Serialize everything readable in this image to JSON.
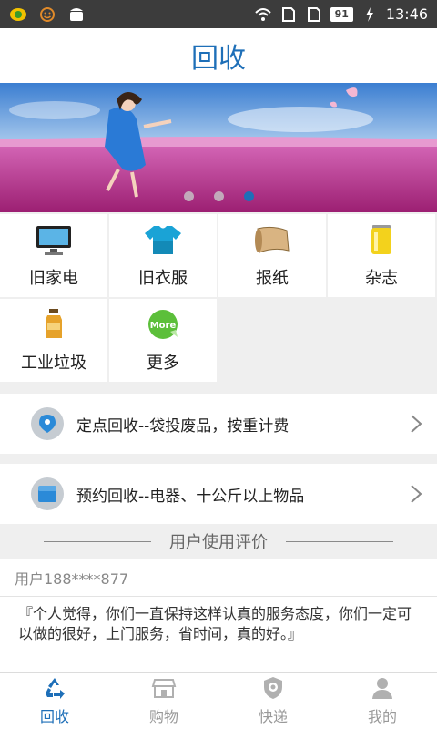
{
  "status_bar": {
    "battery": "91",
    "time": "13:46"
  },
  "header": {
    "title": "回收"
  },
  "banner": {
    "dots": 3,
    "active_dot": 2
  },
  "categories": [
    {
      "label": "旧家电",
      "icon": "monitor-icon"
    },
    {
      "label": "旧衣服",
      "icon": "tshirt-icon"
    },
    {
      "label": "报纸",
      "icon": "paper-scroll-icon"
    },
    {
      "label": "杂志",
      "icon": "can-icon"
    },
    {
      "label": "工业垃圾",
      "icon": "bottle-icon"
    },
    {
      "label": "更多",
      "icon": "more-icon"
    }
  ],
  "list": [
    {
      "text": "定点回收--袋投废品，按重计费",
      "icon": "location-pin-icon"
    },
    {
      "text": "预约回收--电器、十公斤以上物品",
      "icon": "box-icon"
    }
  ],
  "reviews": {
    "section_title": "用户使用评价",
    "user": "用户188****877",
    "text": "『个人觉得，你们一直保持这样认真的服务态度，你们一定可以做的很好，上门服务，省时间，真的好。』"
  },
  "tabs": [
    {
      "label": "回收",
      "icon": "recycle-icon",
      "active": true
    },
    {
      "label": "购物",
      "icon": "shop-icon",
      "active": false
    },
    {
      "label": "快递",
      "icon": "shield-icon",
      "active": false
    },
    {
      "label": "我的",
      "icon": "user-icon",
      "active": false
    }
  ],
  "more_badge": "More",
  "colors": {
    "accent": "#1e6fb8"
  }
}
